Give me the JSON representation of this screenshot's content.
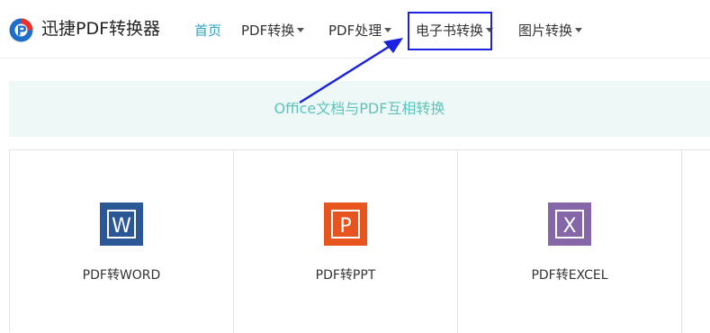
{
  "header": {
    "brand_name": "迅捷PDF转换器",
    "nav": [
      {
        "label": "首页",
        "active": true,
        "has_dropdown": false
      },
      {
        "label": "PDF转换",
        "active": false,
        "has_dropdown": true
      },
      {
        "label": "PDF处理",
        "active": false,
        "has_dropdown": true
      },
      {
        "label": "电子书转换",
        "active": false,
        "has_dropdown": true,
        "highlighted": true
      },
      {
        "label": "图片转换",
        "active": false,
        "has_dropdown": true
      }
    ]
  },
  "banner": {
    "text": "Office文档与PDF互相转换"
  },
  "cards": [
    {
      "label": "PDF转WORD",
      "icon": "word-icon",
      "icon_letter": "W",
      "color": "#2b5797"
    },
    {
      "label": "PDF转PPT",
      "icon": "powerpoint-icon",
      "icon_letter": "P",
      "color": "#e8541f"
    },
    {
      "label": "PDF转EXCEL",
      "icon": "excel-icon",
      "icon_letter": "X",
      "color": "#8567a8"
    }
  ],
  "colors": {
    "active_nav": "#2aa3c6",
    "banner_bg": "#eef8f6",
    "banner_text": "#5dc3bb",
    "annotation_blue": "#1a22e0"
  }
}
